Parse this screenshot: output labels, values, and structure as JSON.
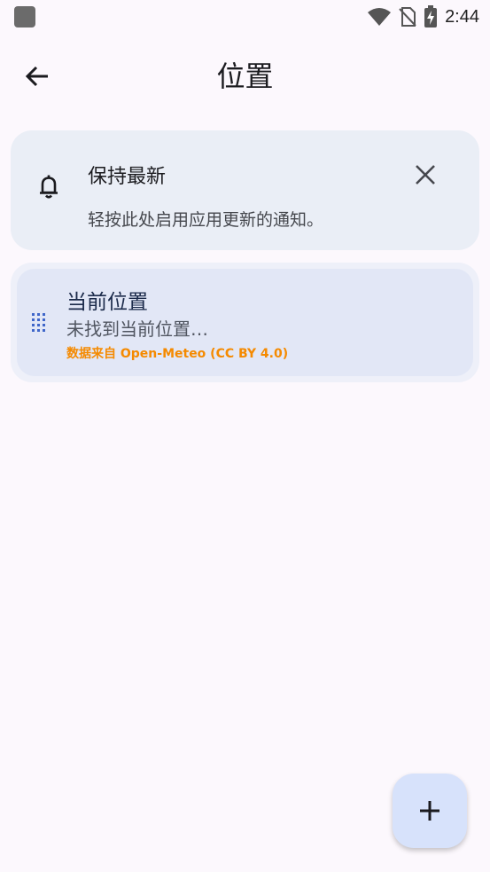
{
  "status_bar": {
    "time": "2:44",
    "icons": [
      "wifi-icon",
      "no-sim-icon",
      "battery-charging-icon"
    ]
  },
  "top_bar": {
    "title": "位置",
    "back_icon": "arrow-left-icon"
  },
  "update_notice": {
    "title": "保持最新",
    "body": "轻按此处启用应用更新的通知。",
    "icon": "bell-icon",
    "dismiss_icon": "close-icon"
  },
  "location": {
    "name": "当前位置",
    "status": "未找到当前位置…",
    "source": "数据来自 Open-Meteo (CC BY 4.0)",
    "handle_icon": "drag-handle-icon"
  },
  "fab": {
    "icon": "plus-icon"
  },
  "colors": {
    "background": "#fcf8fd",
    "notice_card": "#eaeef6",
    "location_card": "#e2e7f6",
    "source_text": "#f58a00",
    "handle": "#3f66c9",
    "fab": "#d7e2fb"
  }
}
